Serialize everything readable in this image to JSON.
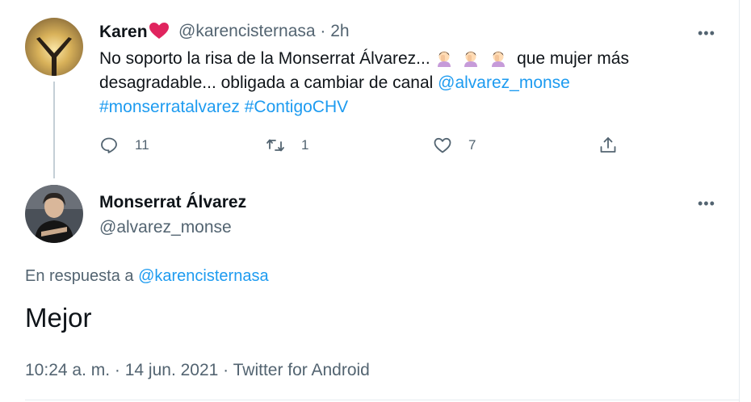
{
  "parent_tweet": {
    "display_name": "Karen",
    "handle": "@karencisternasa",
    "separator": "·",
    "time": "2h",
    "more": "•••",
    "text_part1": "No soporto la risa de la Monserrat Álvarez...",
    "text_part2": "que mujer más desagradable... obligada a cambiar de canal",
    "mention": "@alvarez_monse",
    "hashtag1": "#monserratalvarez",
    "hashtag2": "#ContigoCHV",
    "emoji_name": "person-facepalming-emoji",
    "reply_count": "11",
    "retweet_count": "1",
    "like_count": "7"
  },
  "reply_tweet": {
    "display_name": "Monserrat Álvarez",
    "handle": "@alvarez_monse",
    "more": "•••",
    "reply_to_prefix": "En respuesta a",
    "reply_to_handle": "@karencisternasa",
    "text": "Mejor",
    "timestamp": "10:24 a. m. · 14 jun. 2021 · Twitter for Android"
  },
  "colors": {
    "link": "#1d9bf0",
    "secondary_text": "#536471",
    "heart": "#f91880",
    "thread_line": "#c4cfd6"
  }
}
